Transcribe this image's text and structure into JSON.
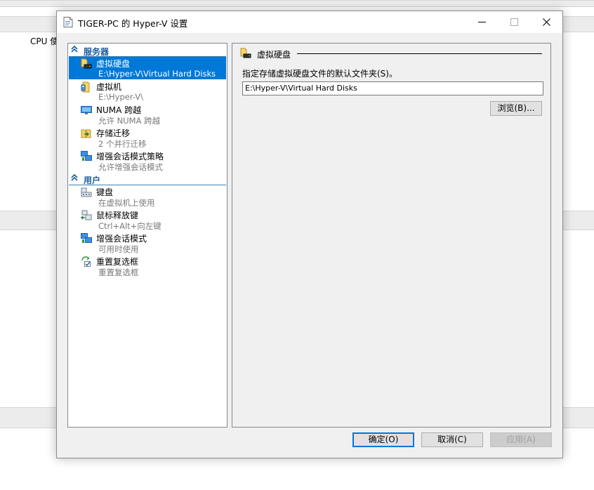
{
  "background": {
    "cpu_label": "CPU 使"
  },
  "dialog": {
    "title": "TIGER-PC 的 Hyper-V 设置",
    "window_controls": {
      "minimize": "—",
      "maximize": "☐",
      "close": "✕"
    }
  },
  "tree": {
    "server_header": "服务器",
    "server_items": [
      {
        "title": "虚拟硬盘",
        "subtitle": "E:\\Hyper-V\\Virtual Hard Disks",
        "icon": "virtual-hard-disk-icon",
        "selected": true
      },
      {
        "title": "虚拟机",
        "subtitle": "E:\\Hyper-V\\",
        "icon": "virtual-machine-icon",
        "selected": false
      },
      {
        "title": "NUMA 跨越",
        "subtitle": "允许 NUMA 跨越",
        "icon": "numa-spanning-icon",
        "selected": false
      },
      {
        "title": "存储迁移",
        "subtitle": "2 个并行迁移",
        "icon": "storage-migration-icon",
        "selected": false
      },
      {
        "title": "增强会话模式策略",
        "subtitle": "允许增强会话模式",
        "icon": "enhanced-session-policy-icon",
        "selected": false
      }
    ],
    "user_header": "用户",
    "user_items": [
      {
        "title": "键盘",
        "subtitle": "在虚拟机上使用",
        "icon": "keyboard-icon",
        "selected": false
      },
      {
        "title": "鼠标释放键",
        "subtitle": "Ctrl+Alt+向左键",
        "icon": "mouse-release-key-icon",
        "selected": false
      },
      {
        "title": "增强会话模式",
        "subtitle": "可用时使用",
        "icon": "enhanced-session-icon",
        "selected": false
      },
      {
        "title": "重置复选框",
        "subtitle": "重置复选框",
        "icon": "reset-checkbox-icon",
        "selected": false
      }
    ]
  },
  "panel": {
    "title": "虚拟硬盘",
    "description": "指定存储虚拟硬盘文件的默认文件夹(S)。",
    "folder_value": "E:\\Hyper-V\\Virtual Hard Disks",
    "browse_label": "浏览(B)..."
  },
  "footer": {
    "ok_label": "确定(O)",
    "cancel_label": "取消(C)",
    "apply_label": "应用(A)"
  },
  "colors": {
    "selection": "#0078d7",
    "section_header": "#1c5c9c",
    "dialog_bg": "#f0f0f0"
  }
}
